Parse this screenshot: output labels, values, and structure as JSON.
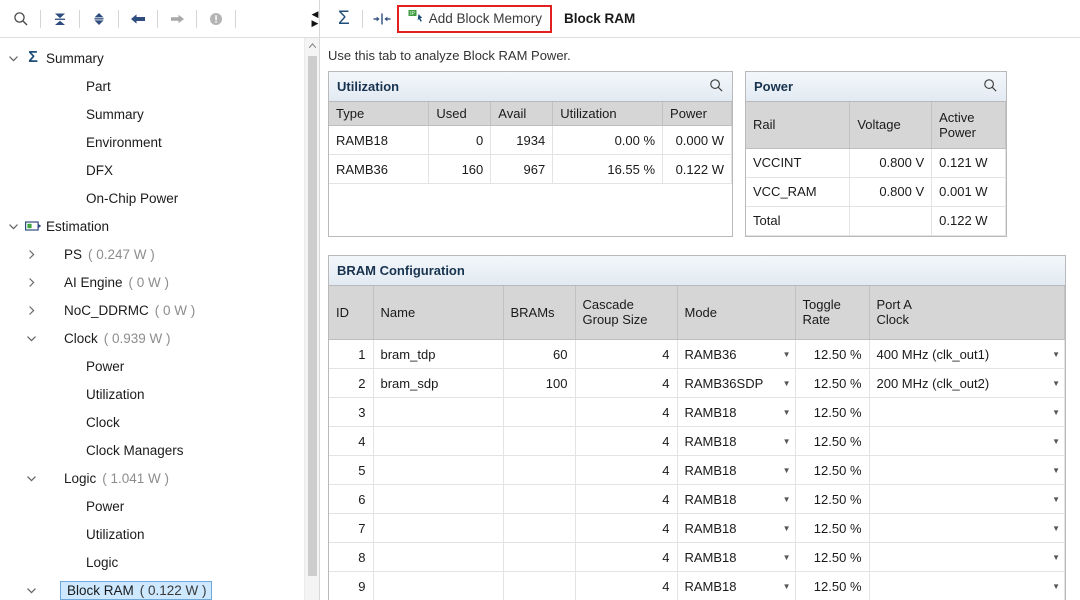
{
  "left_toolbar": {
    "buttons": [
      {
        "name": "search-icon",
        "label": "Search"
      },
      {
        "name": "collapse-all-icon",
        "label": "Collapse All"
      },
      {
        "name": "expand-all-icon",
        "label": "Expand All"
      },
      {
        "name": "back-arrow-icon",
        "label": "Back"
      },
      {
        "name": "forward-arrow-icon",
        "label": "Forward"
      },
      {
        "name": "info-circle-icon",
        "label": "Information"
      }
    ]
  },
  "tree": {
    "items": [
      {
        "label": "Summary",
        "watt": "",
        "level": 0,
        "twisty": "down",
        "icon": "sigma-icon",
        "selected": false
      },
      {
        "label": "Part",
        "watt": "",
        "level": 2,
        "twisty": "none",
        "icon": "none",
        "selected": false
      },
      {
        "label": "Summary",
        "watt": "",
        "level": 2,
        "twisty": "none",
        "icon": "none",
        "selected": false
      },
      {
        "label": "Environment",
        "watt": "",
        "level": 2,
        "twisty": "none",
        "icon": "none",
        "selected": false
      },
      {
        "label": "DFX",
        "watt": "",
        "level": 2,
        "twisty": "none",
        "icon": "none",
        "selected": false
      },
      {
        "label": "On-Chip Power",
        "watt": "",
        "level": 2,
        "twisty": "none",
        "icon": "none",
        "selected": false
      },
      {
        "label": "Estimation",
        "watt": "",
        "level": 0,
        "twisty": "down",
        "icon": "battery-icon",
        "selected": false
      },
      {
        "label": "PS",
        "watt": "( 0.247 W )",
        "level": 1,
        "twisty": "right",
        "icon": "none",
        "selected": false
      },
      {
        "label": "AI Engine",
        "watt": "( 0 W )",
        "level": 1,
        "twisty": "right",
        "icon": "none",
        "selected": false
      },
      {
        "label": "NoC_DDRMC",
        "watt": "( 0 W )",
        "level": 1,
        "twisty": "right",
        "icon": "none",
        "selected": false
      },
      {
        "label": "Clock",
        "watt": "( 0.939 W )",
        "level": 1,
        "twisty": "down",
        "icon": "none",
        "selected": false
      },
      {
        "label": "Power",
        "watt": "",
        "level": 2,
        "twisty": "none",
        "icon": "none",
        "selected": false
      },
      {
        "label": "Utilization",
        "watt": "",
        "level": 2,
        "twisty": "none",
        "icon": "none",
        "selected": false
      },
      {
        "label": "Clock",
        "watt": "",
        "level": 2,
        "twisty": "none",
        "icon": "none",
        "selected": false
      },
      {
        "label": "Clock Managers",
        "watt": "",
        "level": 2,
        "twisty": "none",
        "icon": "none",
        "selected": false
      },
      {
        "label": "Logic",
        "watt": "( 1.041 W )",
        "level": 1,
        "twisty": "down",
        "icon": "none",
        "selected": false
      },
      {
        "label": "Power",
        "watt": "",
        "level": 2,
        "twisty": "none",
        "icon": "none",
        "selected": false
      },
      {
        "label": "Utilization",
        "watt": "",
        "level": 2,
        "twisty": "none",
        "icon": "none",
        "selected": false
      },
      {
        "label": "Logic",
        "watt": "",
        "level": 2,
        "twisty": "none",
        "icon": "none",
        "selected": false
      },
      {
        "label": "Block RAM",
        "watt": "( 0.122 W )",
        "level": 1,
        "twisty": "down",
        "icon": "none",
        "selected": true
      }
    ]
  },
  "right_toolbar": {
    "sigma_glyph": "Σ",
    "split_icon_name": "split-view-icon",
    "add_block_memory_label": "Add Block Memory",
    "tab_title": "Block RAM",
    "highlight_color": "#e32020"
  },
  "hint": "Use this tab to analyze Block RAM Power.",
  "utilization": {
    "title": "Utilization",
    "columns": [
      "Type",
      "Used",
      "Avail",
      "Utilization",
      "Power"
    ],
    "rows": [
      [
        "RAMB18",
        "0",
        "1934",
        "0.00 %",
        "0.000 W"
      ],
      [
        "RAMB36",
        "160",
        "967",
        "16.55 %",
        "0.122 W"
      ]
    ]
  },
  "power": {
    "title": "Power",
    "columns": [
      "Rail",
      "Voltage",
      "Active\nPower"
    ],
    "rows": [
      [
        "VCCINT",
        "0.800 V",
        "0.121 W"
      ],
      [
        "VCC_RAM",
        "0.800 V",
        "0.001 W"
      ],
      [
        "Total",
        "",
        "0.122 W"
      ]
    ]
  },
  "bram_config": {
    "title": "BRAM Configuration",
    "columns": [
      "ID",
      "Name",
      "BRAMs",
      "Cascade\nGroup Size",
      "Mode",
      "Toggle\nRate",
      "Port A\nClock"
    ],
    "rows": [
      {
        "id": "1",
        "name": "bram_tdp",
        "brams": "60",
        "cascade": "4",
        "mode": "RAMB36",
        "toggle": "12.50 %",
        "clock": "400 MHz (clk_out1)"
      },
      {
        "id": "2",
        "name": "bram_sdp",
        "brams": "100",
        "cascade": "4",
        "mode": "RAMB36SDP",
        "toggle": "12.50 %",
        "clock": "200 MHz (clk_out2)"
      },
      {
        "id": "3",
        "name": "",
        "brams": "",
        "cascade": "4",
        "mode": "RAMB18",
        "toggle": "12.50 %",
        "clock": ""
      },
      {
        "id": "4",
        "name": "",
        "brams": "",
        "cascade": "4",
        "mode": "RAMB18",
        "toggle": "12.50 %",
        "clock": ""
      },
      {
        "id": "5",
        "name": "",
        "brams": "",
        "cascade": "4",
        "mode": "RAMB18",
        "toggle": "12.50 %",
        "clock": ""
      },
      {
        "id": "6",
        "name": "",
        "brams": "",
        "cascade": "4",
        "mode": "RAMB18",
        "toggle": "12.50 %",
        "clock": ""
      },
      {
        "id": "7",
        "name": "",
        "brams": "",
        "cascade": "4",
        "mode": "RAMB18",
        "toggle": "12.50 %",
        "clock": ""
      },
      {
        "id": "8",
        "name": "",
        "brams": "",
        "cascade": "4",
        "mode": "RAMB18",
        "toggle": "12.50 %",
        "clock": ""
      },
      {
        "id": "9",
        "name": "",
        "brams": "",
        "cascade": "4",
        "mode": "RAMB18",
        "toggle": "12.50 %",
        "clock": ""
      }
    ]
  },
  "glyphs": {
    "search": "⌕",
    "dropdown": "▼",
    "chevron_up": "˄",
    "tri_left": "◀",
    "tri_right": "▶"
  }
}
